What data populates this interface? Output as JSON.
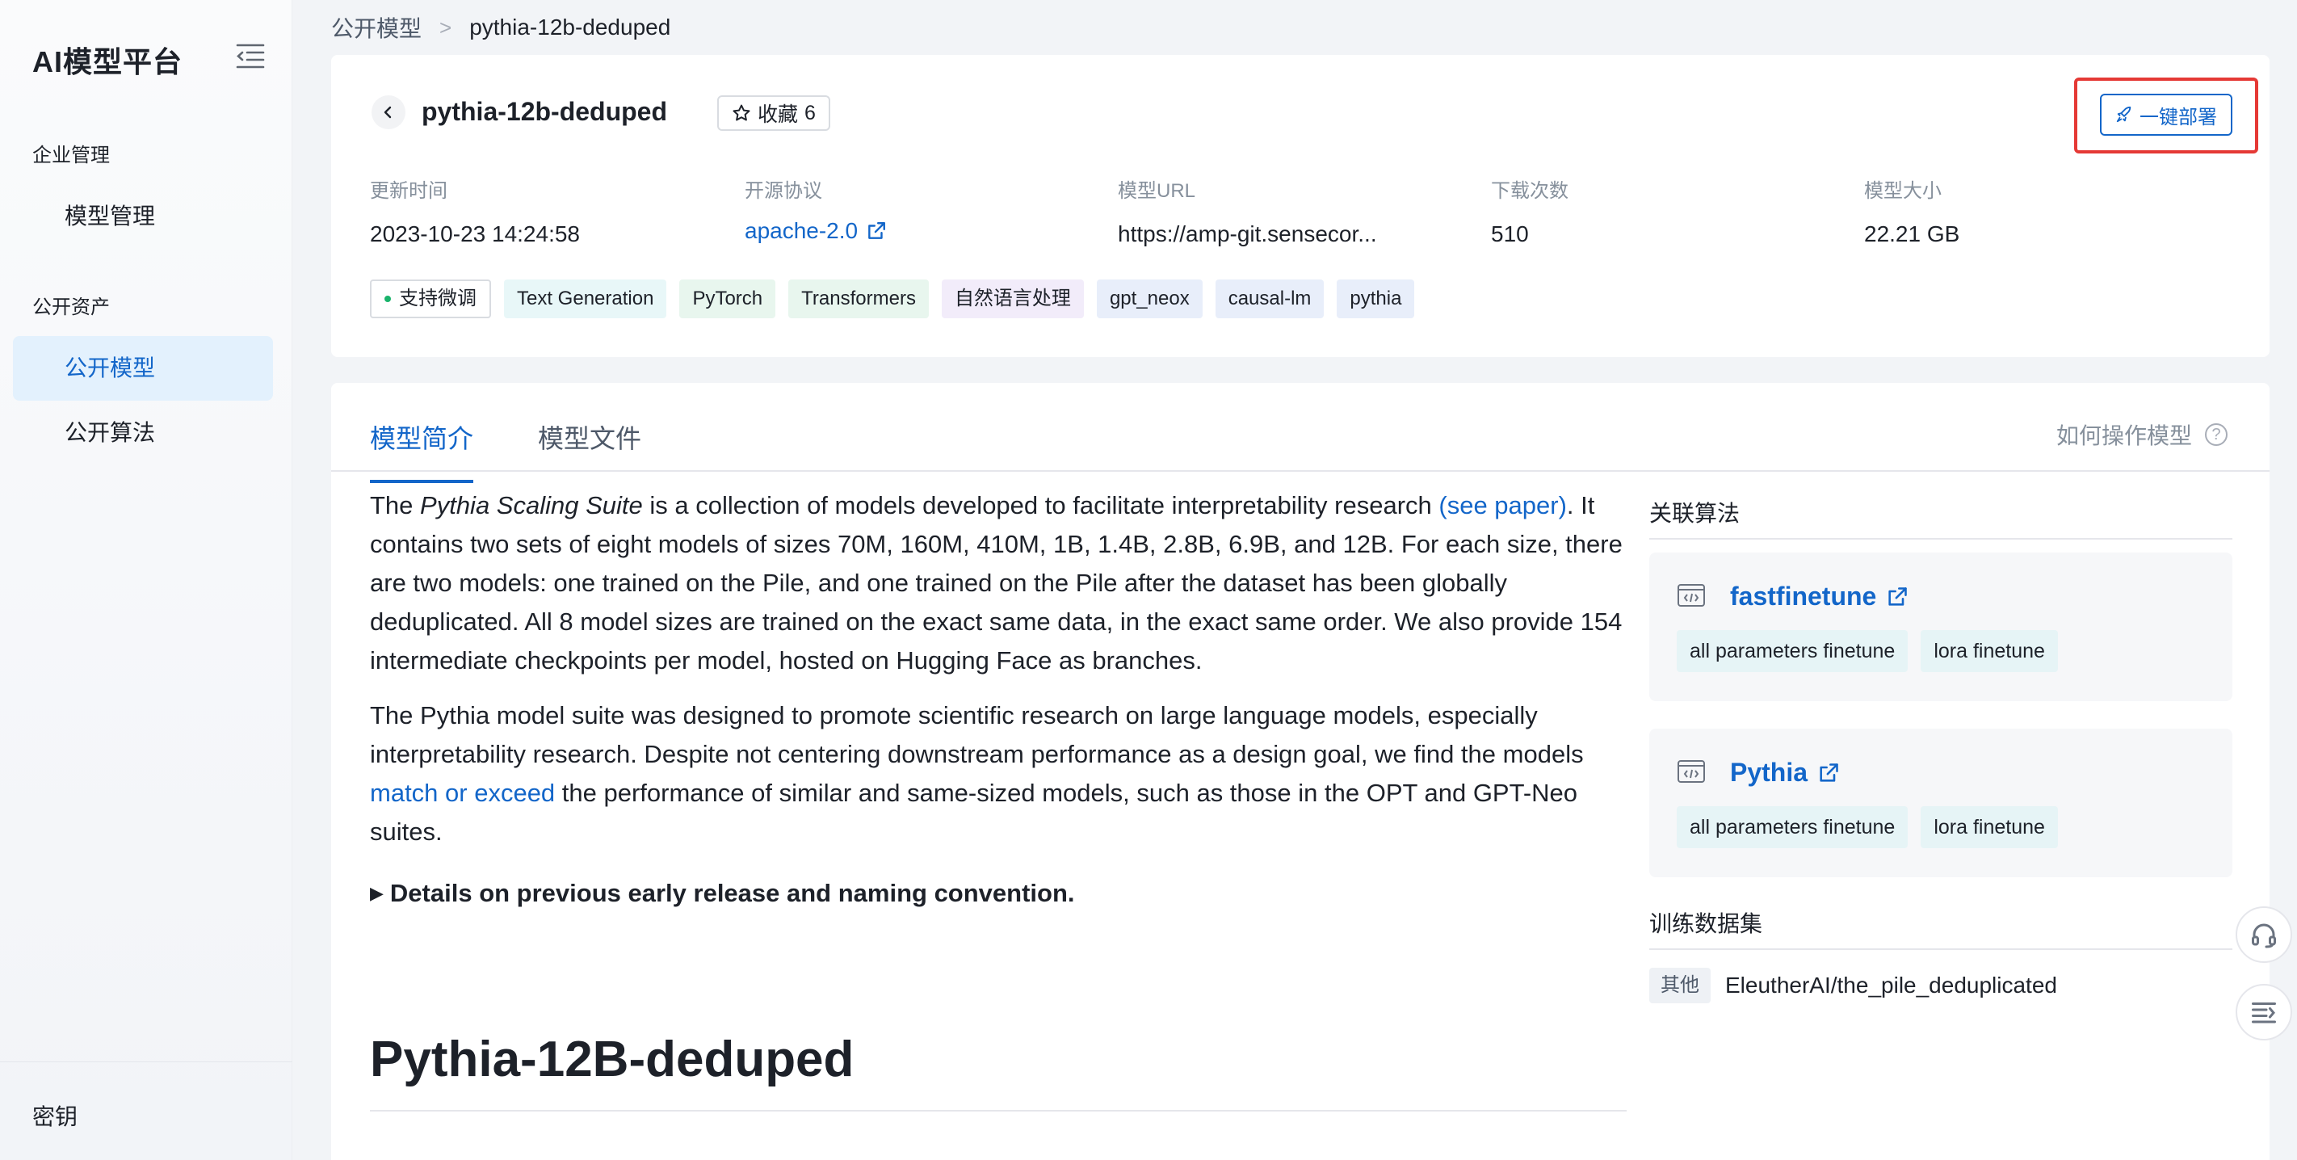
{
  "sidebar": {
    "brand": "AI模型平台",
    "groups": [
      {
        "label": "企业管理",
        "items": [
          "模型管理"
        ]
      },
      {
        "label": "公开资产",
        "items": [
          "公开模型",
          "公开算法"
        ]
      }
    ],
    "active_item": "公开模型",
    "bottom_item": "密钥"
  },
  "breadcrumb": {
    "parent": "公开模型",
    "separator": ">",
    "current": "pythia-12b-deduped"
  },
  "model": {
    "name": "pythia-12b-deduped",
    "favorite_label": "收藏",
    "favorite_count": "6",
    "deploy_label": "一键部署",
    "meta": [
      {
        "label": "更新时间",
        "value": "2023-10-23 14:24:58"
      },
      {
        "label": "开源协议",
        "value": "apache-2.0"
      },
      {
        "label": "模型URL",
        "value": "https://amp-git.sensecor..."
      },
      {
        "label": "下载次数",
        "value": "510"
      },
      {
        "label": "模型大小",
        "value": "22.21 GB"
      }
    ],
    "tags": [
      "支持微调",
      "Text Generation",
      "PyTorch",
      "Transformers",
      "自然语言处理",
      "gpt_neox",
      "causal-lm",
      "pythia"
    ]
  },
  "tabs": [
    "模型简介",
    "模型文件"
  ],
  "help_label": "如何操作模型",
  "content": {
    "p1_a": "The ",
    "p1_em": "Pythia Scaling Suite",
    "p1_b": " is a collection of models developed to facilitate interpretability research ",
    "p1_link": "(see paper)",
    "p1_c": ". It contains two sets of eight models of sizes 70M, 160M, 410M, 1B, 1.4B, 2.8B, 6.9B, and 12B. For each size, there are two models: one trained on the Pile, and one trained on the Pile after the dataset has been globally deduplicated. All 8 model sizes are trained on the exact same data, in the exact same order. We also provide 154 intermediate checkpoints per model, hosted on Hugging Face as branches.",
    "p2_a": "The Pythia model suite was designed to promote scientific research on large language models, especially interpretability research. Despite not centering downstream performance as a design goal, we find the models ",
    "p2_link": "match or exceed",
    "p2_b": " the performance of similar and same-sized models, such as those in the OPT and GPT-Neo suites.",
    "details": "Details on previous early release and naming convention.",
    "heading": "Pythia-12B-deduped"
  },
  "side": {
    "algo_title": "关联算法",
    "algorithms": [
      {
        "name": "fastfinetune",
        "tags": [
          "all parameters finetune",
          "lora finetune"
        ]
      },
      {
        "name": "Pythia",
        "tags": [
          "all parameters finetune",
          "lora finetune"
        ]
      }
    ],
    "dataset_title": "训练数据集",
    "dataset_tag": "其他",
    "dataset_name": "EleutherAI/the_pile_deduplicated"
  },
  "colors": {
    "accent": "#1366c9",
    "highlight": "#e53935",
    "active_nav_bg": "#e3f1fd"
  }
}
